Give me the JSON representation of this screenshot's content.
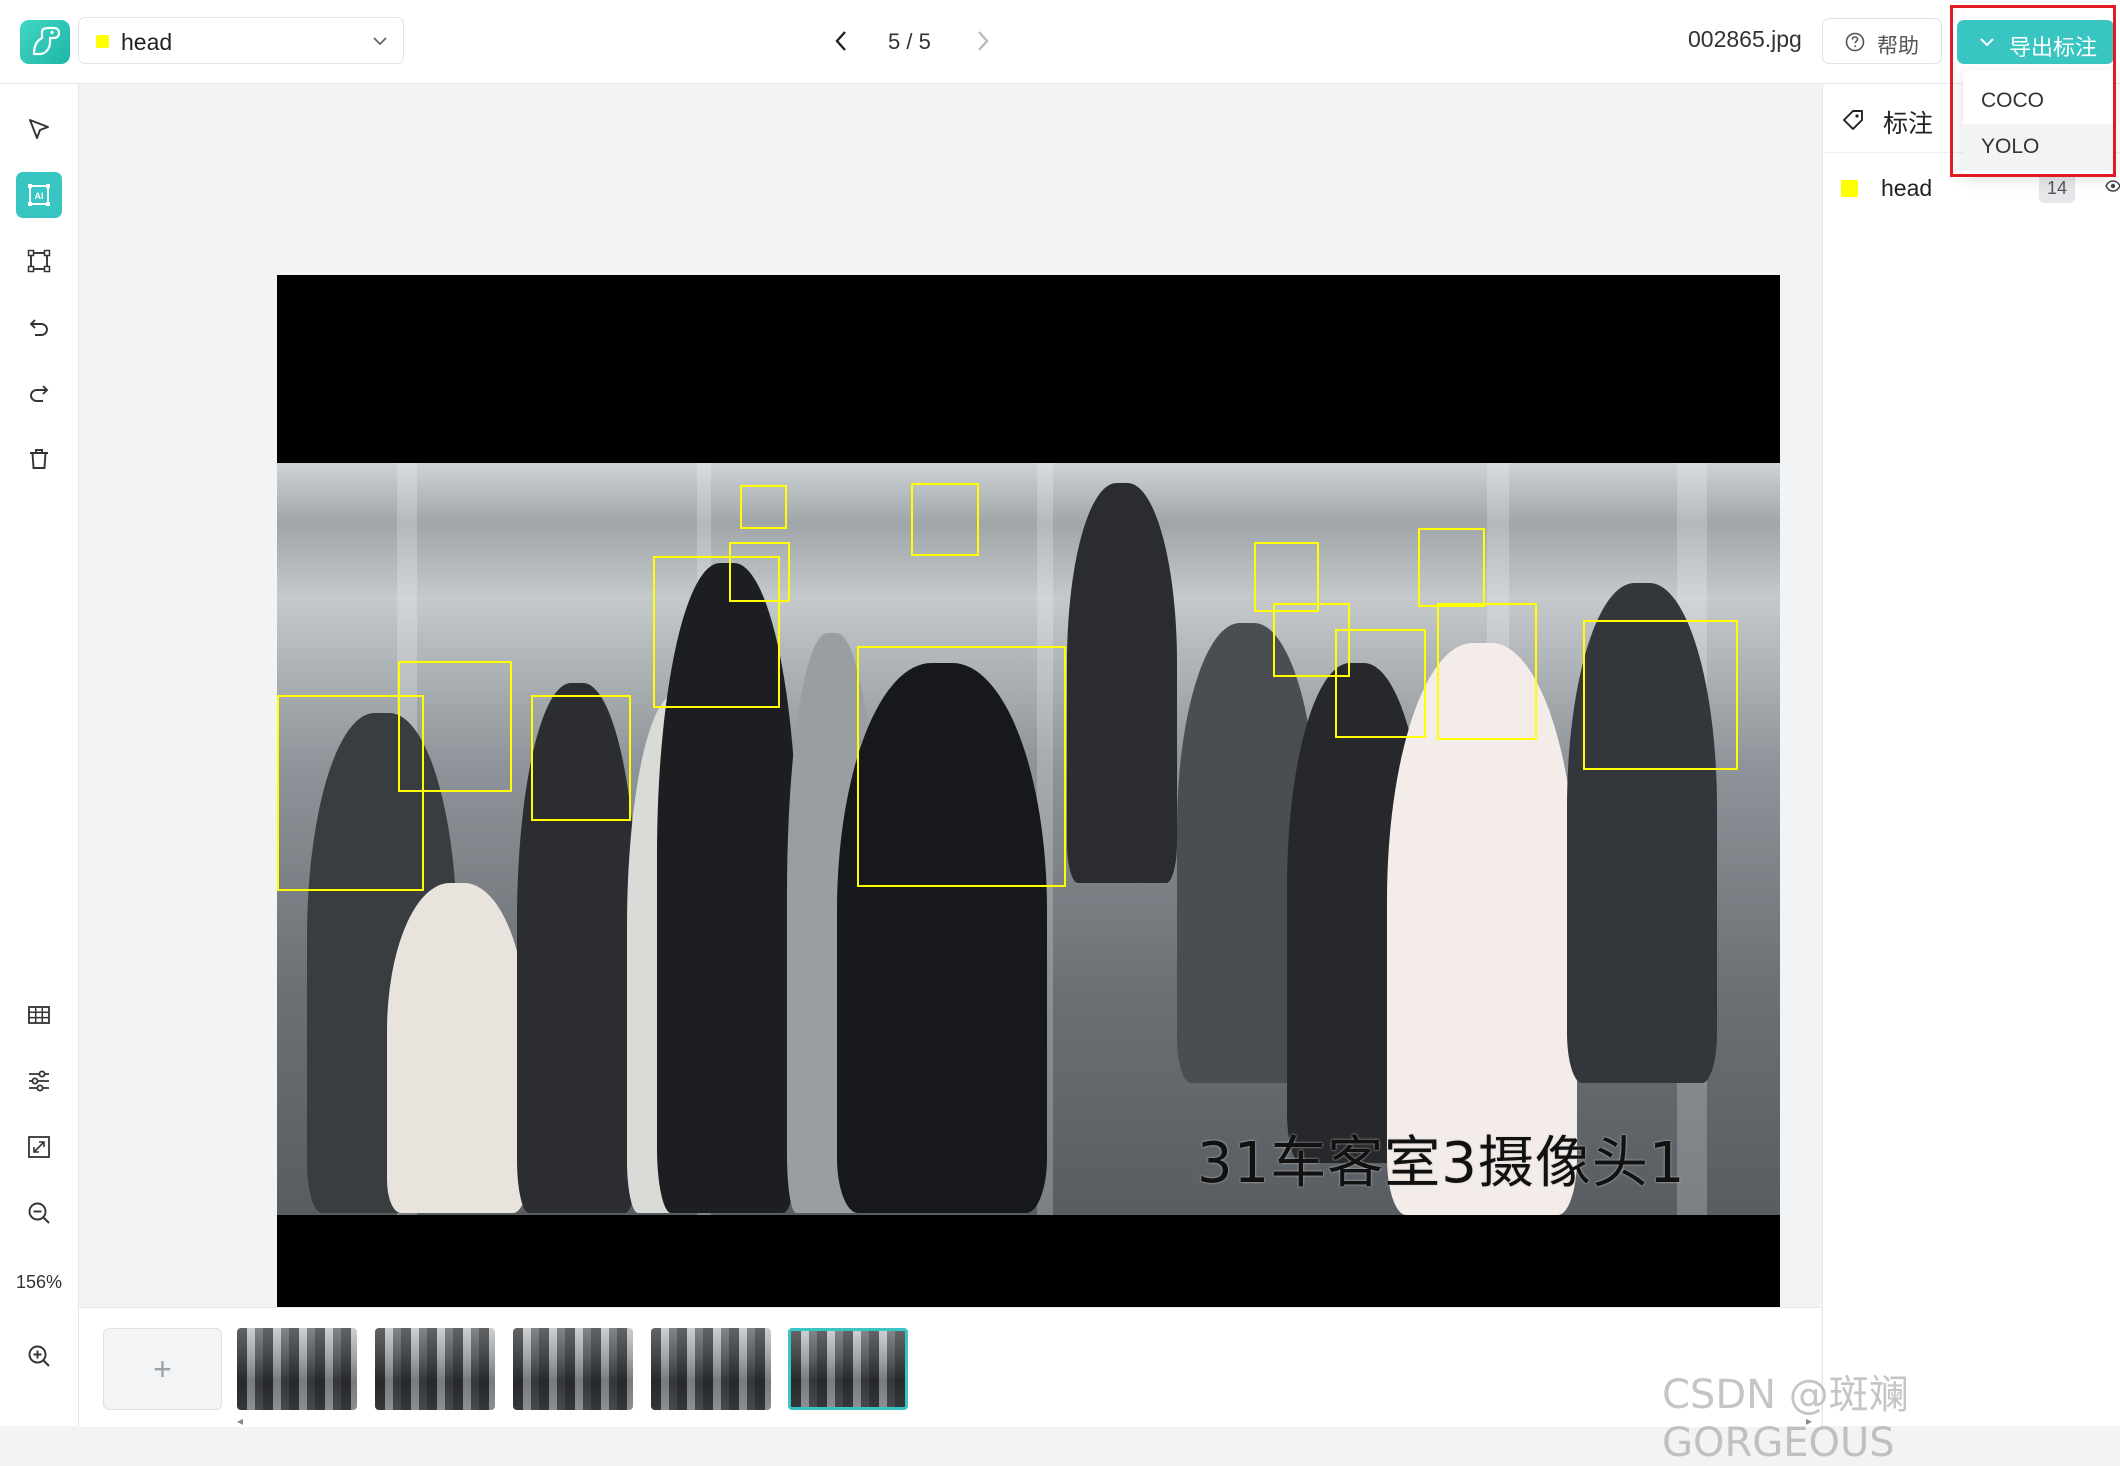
{
  "header": {
    "label_selector": {
      "value": "head",
      "color": "#ffff00"
    },
    "pager": {
      "text": "5 / 5"
    },
    "filename": "002865.jpg",
    "help_label": "帮助",
    "export_label": "导出标注",
    "export_options": [
      "COCO",
      "YOLO"
    ],
    "export_selected": "YOLO"
  },
  "toolbar": {
    "tools": [
      "select-cursor-icon",
      "ai-box-icon",
      "rectangle-icon",
      "undo-icon",
      "redo-icon",
      "trash-icon"
    ],
    "active_tool": "ai-box-icon",
    "bottom_tools": [
      "grid-icon",
      "sliders-icon",
      "fit-screen-icon",
      "zoom-out-icon",
      "zoom-in-icon"
    ],
    "zoom_level": "156%"
  },
  "canvas": {
    "overlay_caption": "31车客室3摄像头1",
    "box_color": "#ffff00"
  },
  "filmstrip": {
    "add_label": "+",
    "thumbnail_count": 5,
    "current_index": 5
  },
  "annotations_panel": {
    "title": "标注",
    "labels": [
      {
        "name": "head",
        "count": "14",
        "color": "#ffff00"
      }
    ]
  },
  "colors": {
    "accent": "#39c6c2",
    "highlight": "#e01b24"
  },
  "watermark": "CSDN @斑斓GORGEOUS"
}
